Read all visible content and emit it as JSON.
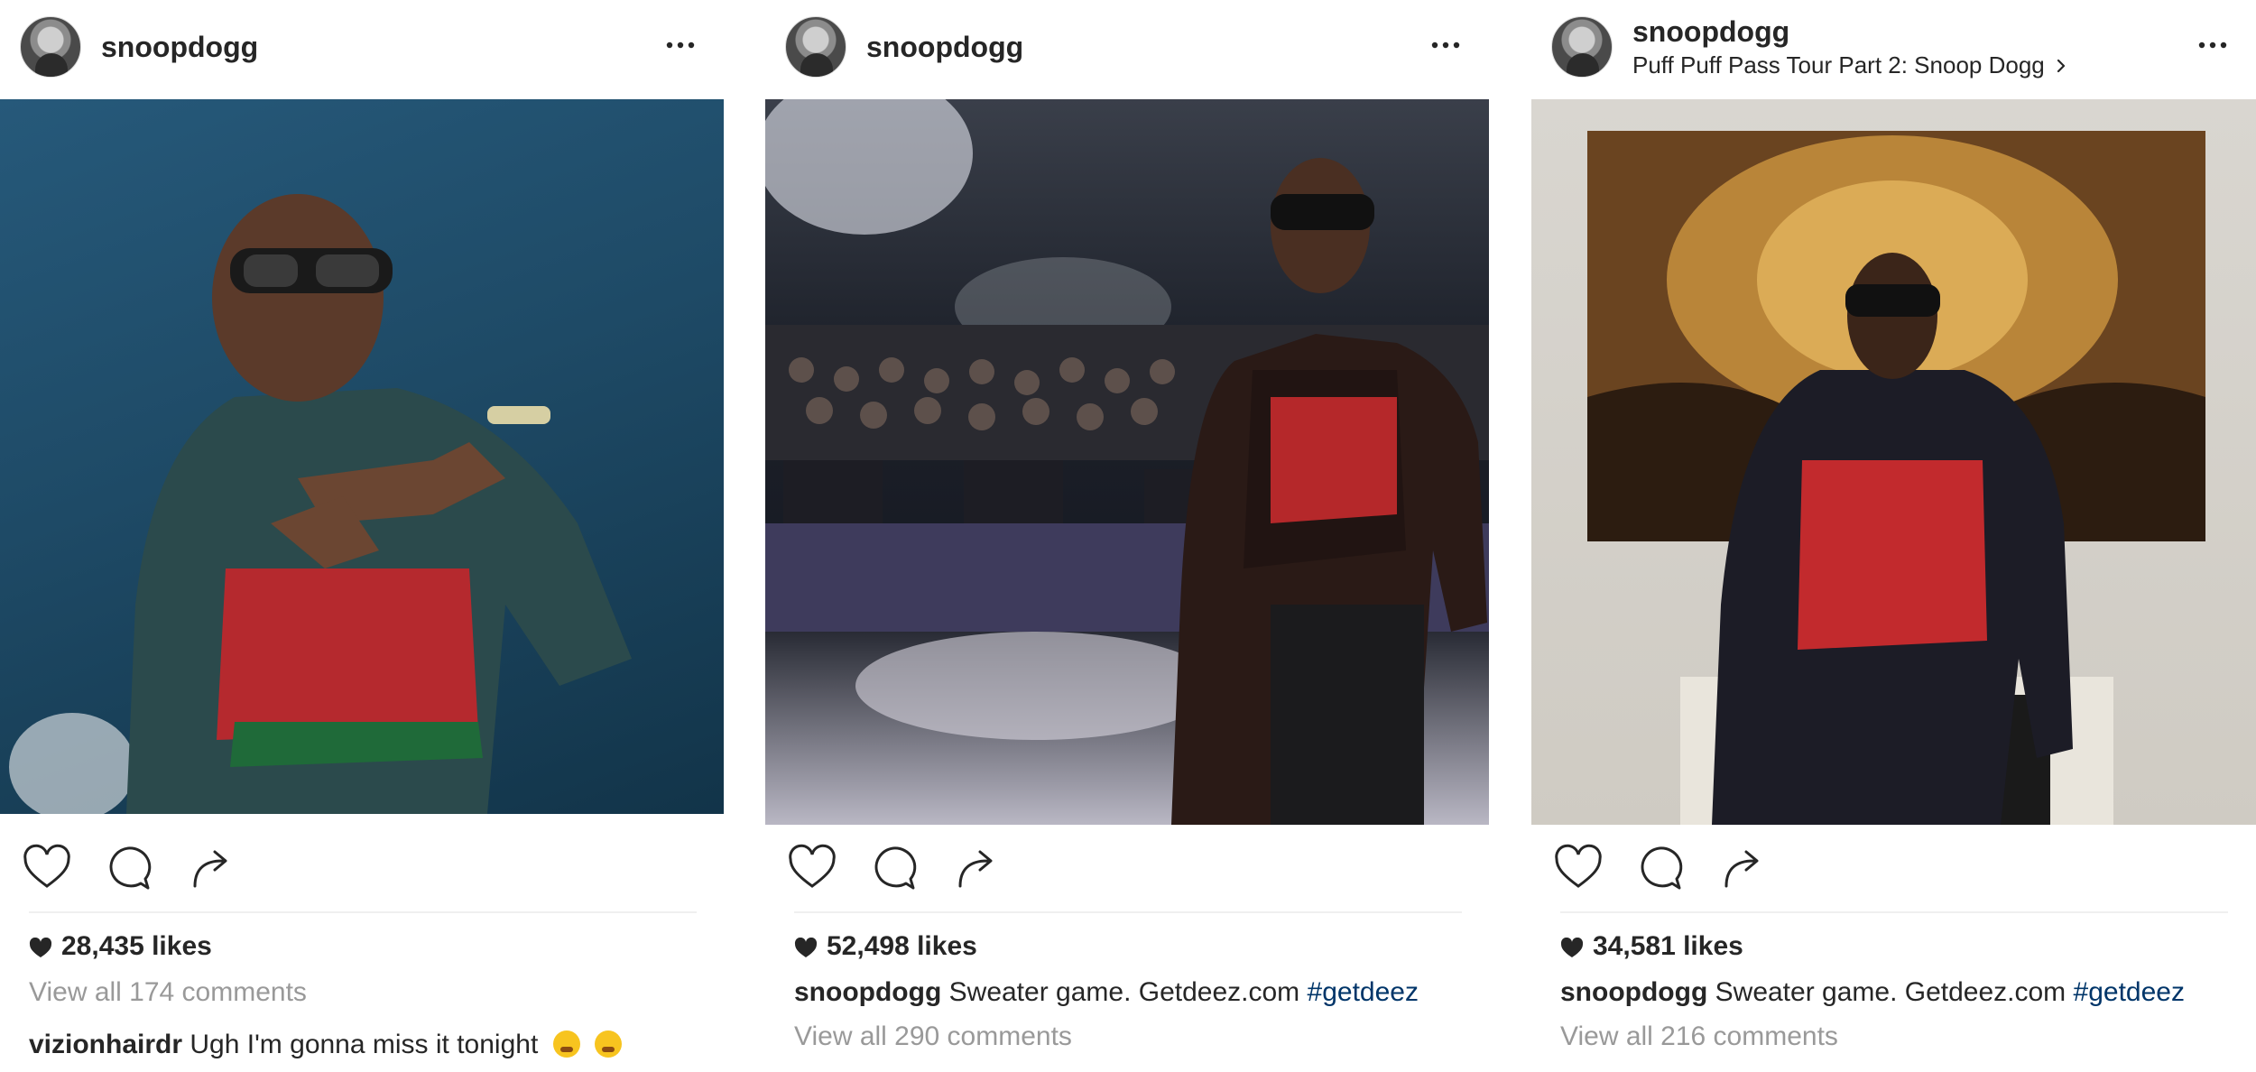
{
  "posts": [
    {
      "username": "snoopdogg",
      "location": "",
      "likes": "28,435 likes",
      "caption_user": "",
      "caption_text": "",
      "caption_tag": "",
      "view_all": "View all 174 comments",
      "comment_user": "vizionhairdr",
      "comment_text": "Ugh I'm gonna miss it tonight",
      "comment_emojis": [
        "tired-face-emoji",
        "weary-face-emoji"
      ]
    },
    {
      "username": "snoopdogg",
      "location": "",
      "likes": "52,498 likes",
      "caption_user": "snoopdogg",
      "caption_text": "Sweater game. Getdeez.com",
      "caption_tag": "#getdeez",
      "view_all": "View all 290 comments"
    },
    {
      "username": "snoopdogg",
      "location": "Puff Puff Pass Tour Part 2: Snoop Dogg",
      "likes": "34,581 likes",
      "caption_user": "snoopdogg",
      "caption_text": "Sweater game. Getdeez.com",
      "caption_tag": "#getdeez",
      "view_all": "View all 216 comments"
    }
  ],
  "icons": {
    "more": "more-options-icon",
    "like": "heart-icon",
    "comment": "comment-bubble-icon",
    "share": "share-arrow-icon",
    "likes_heart": "filled-heart-icon",
    "location_chevron": "chevron-right-icon"
  },
  "colors": {
    "text": "#262626",
    "muted": "#999999",
    "hashtag": "#003569",
    "divider": "#efefef"
  }
}
